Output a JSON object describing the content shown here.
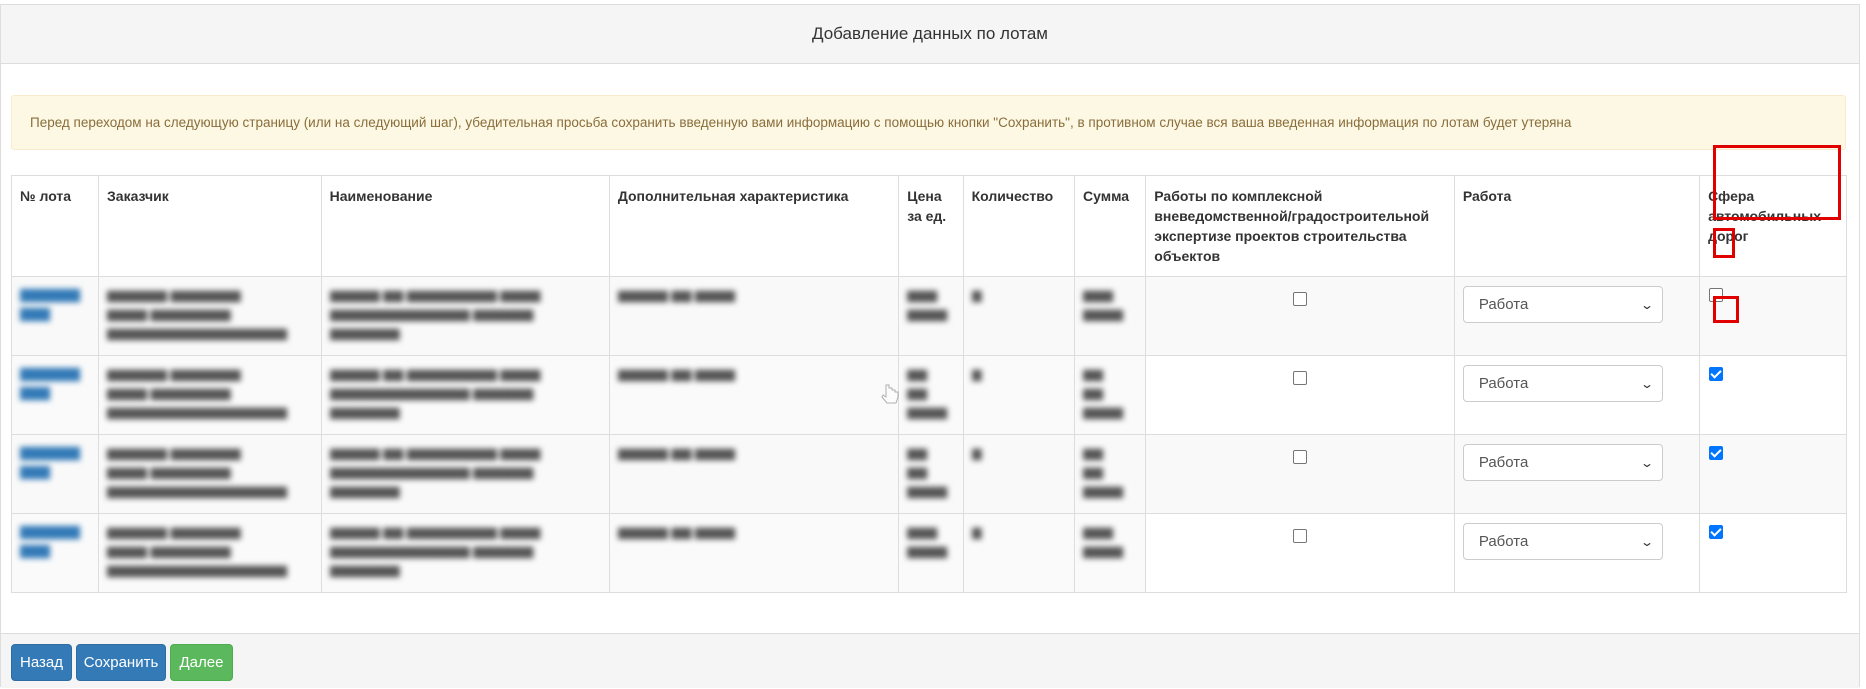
{
  "header": {
    "title": "Добавление данных по лотам"
  },
  "alert": {
    "text": "Перед переходом на следующую страницу (или на следующий шаг), убедительная просьба сохранить введенную вами информацию с помощью кнопки \"Сохранить\", в противном случае вся ваша введенная информация по лотам будет утеряна"
  },
  "table": {
    "headers": {
      "lot": "№ лота",
      "customer": "Заказчик",
      "name": "Наименование",
      "extra": "Дополнительная характеристика",
      "price": "Цена за ед.",
      "qty": "Количество",
      "sum": "Сумма",
      "expertise": "Работы по комплексной вневедомственной/градостроительной экспертизе проектов строительства объектов",
      "work": "Работа",
      "roads": "Сфера автомобильных дорог"
    },
    "rows": [
      {
        "expertise_checked": false,
        "work_value": "Работа",
        "roads_checked": false
      },
      {
        "expertise_checked": false,
        "work_value": "Работа",
        "roads_checked": true
      },
      {
        "expertise_checked": false,
        "work_value": "Работа",
        "roads_checked": true
      },
      {
        "expertise_checked": false,
        "work_value": "Работа",
        "roads_checked": true
      }
    ]
  },
  "footer": {
    "back_label": "Назад",
    "save_label": "Сохранить",
    "next_label": "Далее"
  },
  "colors": {
    "primary": "#337ab7",
    "success": "#5cb85c",
    "alert_bg": "#fcf8e3",
    "highlight": "#e00000"
  }
}
